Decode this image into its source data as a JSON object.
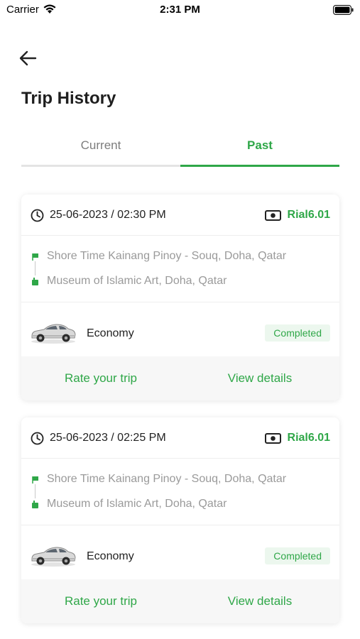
{
  "status_bar": {
    "carrier": "Carrier",
    "time": "2:31 PM"
  },
  "colors": {
    "accent": "#2fa748",
    "badge_bg": "#ecf7ee",
    "muted": "#9a9a9a"
  },
  "header": {
    "title": "Trip History"
  },
  "tabs": [
    {
      "label": "Current",
      "active": false
    },
    {
      "label": "Past",
      "active": true
    }
  ],
  "trips": [
    {
      "datetime": "25-06-2023 / 02:30 PM",
      "fare": "Rial6.01",
      "pickup": "Shore Time Kainang Pinoy - Souq, Doha, Qatar",
      "dropoff": "Museum of Islamic Art, Doha, Qatar",
      "vehicle": "Economy",
      "status": "Completed",
      "actions": {
        "rate": "Rate your trip",
        "details": "View details"
      }
    },
    {
      "datetime": "25-06-2023 / 02:25 PM",
      "fare": "Rial6.01",
      "pickup": "Shore Time Kainang Pinoy - Souq, Doha, Qatar",
      "dropoff": "Museum of Islamic Art, Doha, Qatar",
      "vehicle": "Economy",
      "status": "Completed",
      "actions": {
        "rate": "Rate your trip",
        "details": "View details"
      }
    }
  ]
}
